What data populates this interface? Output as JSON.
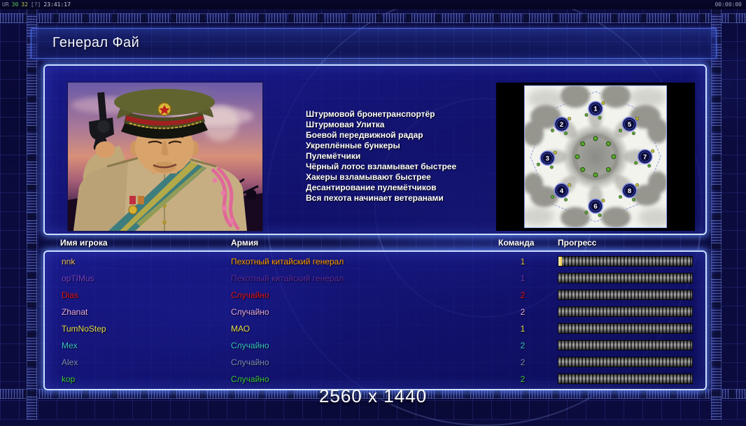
{
  "statusbar": {
    "left_segments": [
      {
        "text": "UR",
        "color": "#8890a8"
      },
      {
        "text": "30",
        "color": "#58c858"
      },
      {
        "text": "32",
        "color": "#b8c848"
      },
      {
        "text": "[?]",
        "color": "#8890a8"
      },
      {
        "text": "23:41:17",
        "color": "#c8ccd8"
      }
    ],
    "right_time": "00:00:00"
  },
  "header": {
    "title": "Генерал Фай"
  },
  "abilities": [
    "Штурмовой бронетранспортёр",
    "Штурмовая Улитка",
    "Боевой передвижной радар",
    "Укреплённые бункеры",
    "Пулемётчики",
    "Чёрный лотос взламывает быстрее",
    "Хакеры взламывают быстрее",
    "Десантирование пулемётчиков",
    "Вся пехота начинает ветеранами"
  ],
  "minimap": {
    "markers": [
      {
        "num": "1",
        "x": 50,
        "y": 16
      },
      {
        "num": "2",
        "x": 26,
        "y": 27
      },
      {
        "num": "5",
        "x": 74,
        "y": 27
      },
      {
        "num": "3",
        "x": 16,
        "y": 51
      },
      {
        "num": "7",
        "x": 85,
        "y": 50
      },
      {
        "num": "4",
        "x": 26,
        "y": 74
      },
      {
        "num": "8",
        "x": 74,
        "y": 74
      },
      {
        "num": "6",
        "x": 50,
        "y": 85
      }
    ]
  },
  "players_table": {
    "headers": {
      "name": "Имя игрока",
      "army": "Армия",
      "team": "Команда",
      "progress": "Прогресс"
    },
    "rows": [
      {
        "name": "nnk",
        "army": "Пехотный китайский генерал",
        "team": "1",
        "name_color": "#e8be5a",
        "army_color": "#ff9c00",
        "team_color": "#d8c040",
        "progress_pct": 2.5
      },
      {
        "name": "opTIMus",
        "army": "Пехотный китайский генерал",
        "team": "1",
        "name_color": "#7a42cc",
        "army_color": "#5f2ca8",
        "team_color": "#6a38b8",
        "progress_pct": 0
      },
      {
        "name": "Dias",
        "army": "Случайно",
        "team": "2",
        "name_color": "#e01414",
        "army_color": "#e01414",
        "team_color": "#e01414",
        "progress_pct": 0
      },
      {
        "name": "Zhanat",
        "army": "Случайно",
        "team": "2",
        "name_color": "#e4aade",
        "army_color": "#e4aade",
        "team_color": "#e4aade",
        "progress_pct": 0
      },
      {
        "name": "TumNoStep",
        "army": "МАО",
        "team": "1",
        "name_color": "#e4de52",
        "army_color": "#e4de52",
        "team_color": "#e4de52",
        "progress_pct": 0
      },
      {
        "name": "Mex",
        "army": "Случайно",
        "team": "2",
        "name_color": "#38c6c6",
        "army_color": "#38c6c6",
        "team_color": "#38c6c6",
        "progress_pct": 0
      },
      {
        "name": "Alex",
        "army": "Случайно",
        "team": "2",
        "name_color": "#7b8cba",
        "army_color": "#7b8cba",
        "team_color": "#7b8cba",
        "progress_pct": 0
      },
      {
        "name": "kop",
        "army": "Случайно",
        "team": "2",
        "name_color": "#3ac63a",
        "army_color": "#3ac63a",
        "team_color": "#3ac63a",
        "progress_pct": 0
      }
    ]
  },
  "footer": {
    "resolution": "2560 x 1440"
  },
  "colors": {
    "panel_glow_border": "#ccdfff",
    "panel_interior": "#15157d",
    "grid_line": "#5564e1",
    "progress_fill": "#f2c238"
  }
}
